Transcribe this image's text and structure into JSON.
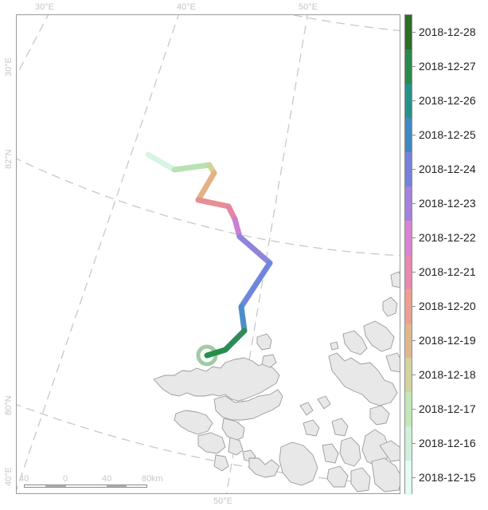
{
  "map": {
    "longitude_labels_top": [
      "30°E",
      "40°E",
      "50°E"
    ],
    "longitude_label_bottom": "50°E",
    "latitude_labels_left": [
      "30°E",
      "82°N",
      "80°N",
      "40°E"
    ],
    "track_start_date": "2018-12-28",
    "track_colors": [
      "#d8f4e4",
      "#b9e2b3",
      "#cfd597",
      "#e4b186",
      "#e78e96",
      "#e684a2",
      "#cc7fd4",
      "#8f84dc",
      "#6f86dc",
      "#4b8dc8",
      "#2e8c57",
      "#248f4b",
      "#1f7c2e"
    ],
    "land_color": "#e8e8e8",
    "land_stroke": "#9a9a9a",
    "graticule_color": "#c8c8c8"
  },
  "legend": {
    "entries": [
      {
        "label": "2018-12-28",
        "color": "#2d6e26"
      },
      {
        "label": "2018-12-27",
        "color": "#2a8a4d"
      },
      {
        "label": "2018-12-26",
        "color": "#259188"
      },
      {
        "label": "2018-12-25",
        "color": "#4189c2"
      },
      {
        "label": "2018-12-24",
        "color": "#7681db"
      },
      {
        "label": "2018-12-23",
        "color": "#a482dd"
      },
      {
        "label": "2018-12-22",
        "color": "#d983d3"
      },
      {
        "label": "2018-12-21",
        "color": "#ea89ad"
      },
      {
        "label": "2018-12-20",
        "color": "#ec9e91"
      },
      {
        "label": "2018-12-19",
        "color": "#e0b78c"
      },
      {
        "label": "2018-12-18",
        "color": "#d3d39d"
      },
      {
        "label": "2018-12-17",
        "color": "#c3e7b6"
      },
      {
        "label": "2018-12-16",
        "color": "#cdf1da"
      },
      {
        "label": "2018-12-15",
        "color": "#e3fcf5"
      }
    ]
  },
  "scalebar": {
    "labels": [
      "40",
      "0",
      "40",
      "80"
    ],
    "unit": "km"
  }
}
